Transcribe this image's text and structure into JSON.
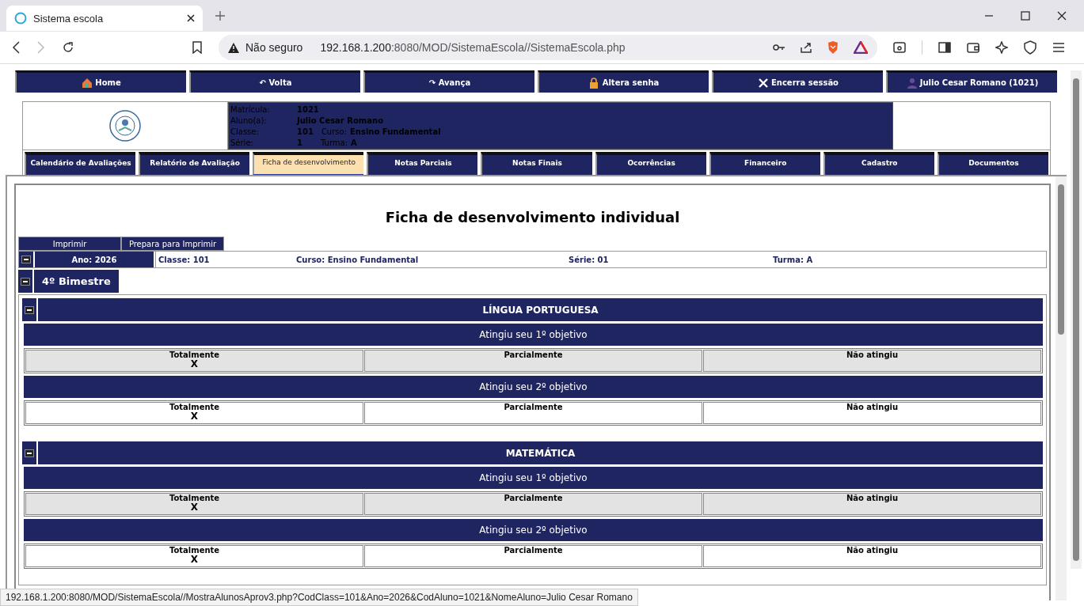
{
  "browser": {
    "tab_title": "Sistema escola",
    "security": "Não seguro",
    "url_host": "192.168.1.200",
    "url_rest": ":8080/MOD/SistemaEscola//SistemaEscola.php"
  },
  "top_nav": [
    {
      "kind": "house",
      "label": "Home"
    },
    {
      "kind": "text",
      "label": "↶ Volta"
    },
    {
      "kind": "text",
      "label": "↷ Avança"
    },
    {
      "kind": "lock",
      "label": "Altera senha"
    },
    {
      "kind": "close",
      "label": "Encerra sessão"
    },
    {
      "kind": "user",
      "label": "Julio Cesar Romano (1021)"
    }
  ],
  "student": [
    {
      "label": "Matrícula:",
      "value": "1021"
    },
    {
      "label": "Aluno(a):",
      "value": "Julio Cesar Romano"
    },
    {
      "label": "Classe:",
      "value": "101",
      "label2": "Curso:",
      "value2": "Ensino Fundamental"
    },
    {
      "label": "Série:",
      "value": "1",
      "label2": "Turma:",
      "value2": "A"
    }
  ],
  "tabs": [
    {
      "label": "Calendário de Avaliações",
      "selected": false
    },
    {
      "label": "Relatório de Avaliação",
      "selected": false
    },
    {
      "label": "Ficha de desenvolvimento",
      "selected": true
    },
    {
      "label": "Notas Parciais",
      "selected": false
    },
    {
      "label": "Notas Finais",
      "selected": false
    },
    {
      "label": "Ocorrências",
      "selected": false
    },
    {
      "label": "Financeiro",
      "selected": false
    },
    {
      "label": "Cadastro",
      "selected": false
    },
    {
      "label": "Documentos",
      "selected": false
    }
  ],
  "page_title": "Ficha de desenvolvimento individual",
  "actions": [
    "Imprimir",
    "Prepara para Imprimir"
  ],
  "year": {
    "label": "Ano: 2026",
    "expanded": true,
    "fields": [
      "Classe: 101",
      "Curso: Ensino Fundamental",
      "Série: 01",
      "Turma: A"
    ]
  },
  "period": {
    "label": "4º Bimestre",
    "expanded": true
  },
  "subjects": [
    {
      "name": "LÍNGUA PORTUGUESA",
      "expanded": true,
      "objectives": [
        {
          "title": "Atingiu seu 1º objetivo",
          "options": [
            {
              "label": "Totalmente",
              "mark": "X"
            },
            {
              "label": "Parcialmente"
            },
            {
              "label": "Não atingiu"
            }
          ]
        },
        {
          "title": "Atingiu seu 2º objetivo",
          "options": [
            {
              "label": "Totalmente",
              "mark": "X"
            },
            {
              "label": "Parcialmente"
            },
            {
              "label": "Não atingiu"
            }
          ]
        }
      ]
    },
    {
      "name": "MATEMÁTICA",
      "expanded": true,
      "objectives": [
        {
          "title": "Atingiu seu 1º objetivo",
          "options": [
            {
              "label": "Totalmente",
              "mark": "X"
            },
            {
              "label": "Parcialmente"
            },
            {
              "label": "Não atingiu"
            }
          ]
        },
        {
          "title": "Atingiu seu 2º objetivo",
          "options": [
            {
              "label": "Totalmente",
              "mark": "X"
            },
            {
              "label": "Parcialmente"
            },
            {
              "label": "Não atingiu"
            }
          ]
        }
      ]
    }
  ],
  "status_url": "192.168.1.200:8080/MOD/SistemaEscola//MostraAlunosAprov3.php?CodClass=101&Ano=2026&CodAluno=1021&NomeAluno=Julio Cesar Romano"
}
